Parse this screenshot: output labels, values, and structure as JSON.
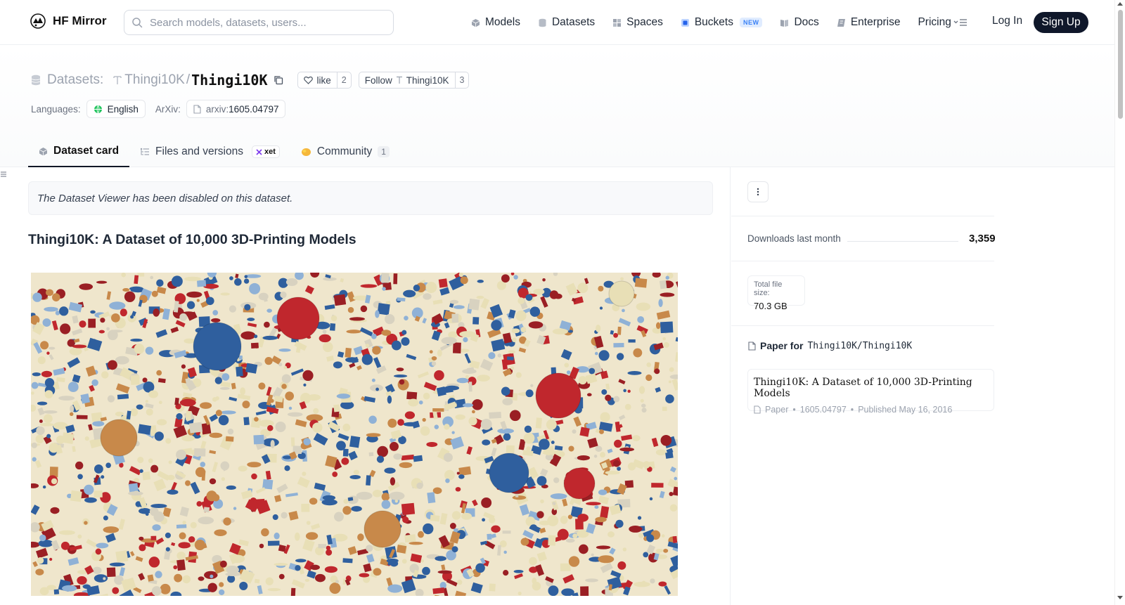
{
  "nav": {
    "brand": "HF Mirror",
    "search_placeholder": "Search models, datasets, users...",
    "links": {
      "models": "Models",
      "datasets": "Datasets",
      "spaces": "Spaces",
      "buckets": "Buckets",
      "buckets_badge": "NEW",
      "docs": "Docs",
      "enterprise": "Enterprise",
      "pricing": "Pricing"
    },
    "login": "Log In",
    "signup": "Sign Up"
  },
  "header": {
    "crumb_label": "Datasets:",
    "org": "Thingi10K",
    "slash": "/",
    "repo": "Thingi10K",
    "like_label": "like",
    "like_count": "2",
    "follow_label": "Follow",
    "follow_org": "Thingi10K",
    "follow_count": "3",
    "languages_label": "Languages:",
    "language": "English",
    "arxiv_label": "ArXiv:",
    "arxiv_prefix": "arxiv:",
    "arxiv_id": "1605.04797"
  },
  "tabs": {
    "dataset_card": "Dataset card",
    "files": "Files and versions",
    "xet_badge": "xet",
    "community": "Community",
    "community_count": "1"
  },
  "main": {
    "notice": "The Dataset Viewer has been disabled on this dataset.",
    "card_title": "Thingi10K: A Dataset of 10,000 3D-Printing Models"
  },
  "sidebar": {
    "downloads_label": "Downloads last month",
    "downloads_value": "3,359",
    "size_label": "Total file size:",
    "size_value": "70.3 GB",
    "paper_for": "Paper for",
    "paper_repo": "Thingi10K/Thingi10K",
    "paper_title": "Thingi10K: A Dataset of 10,000 3D-Printing Models",
    "paper_type": "Paper",
    "paper_id": "1605.04797",
    "paper_published": "Published May 16, 2016",
    "dot": "•"
  },
  "colors": {
    "accent_dark": "#0f172a",
    "badge_blue": "#3b82f6",
    "hero_red": "#c0272d",
    "hero_blue": "#2f5f9e",
    "hero_cream": "#e8dfb6",
    "hero_tan": "#c8894a"
  }
}
